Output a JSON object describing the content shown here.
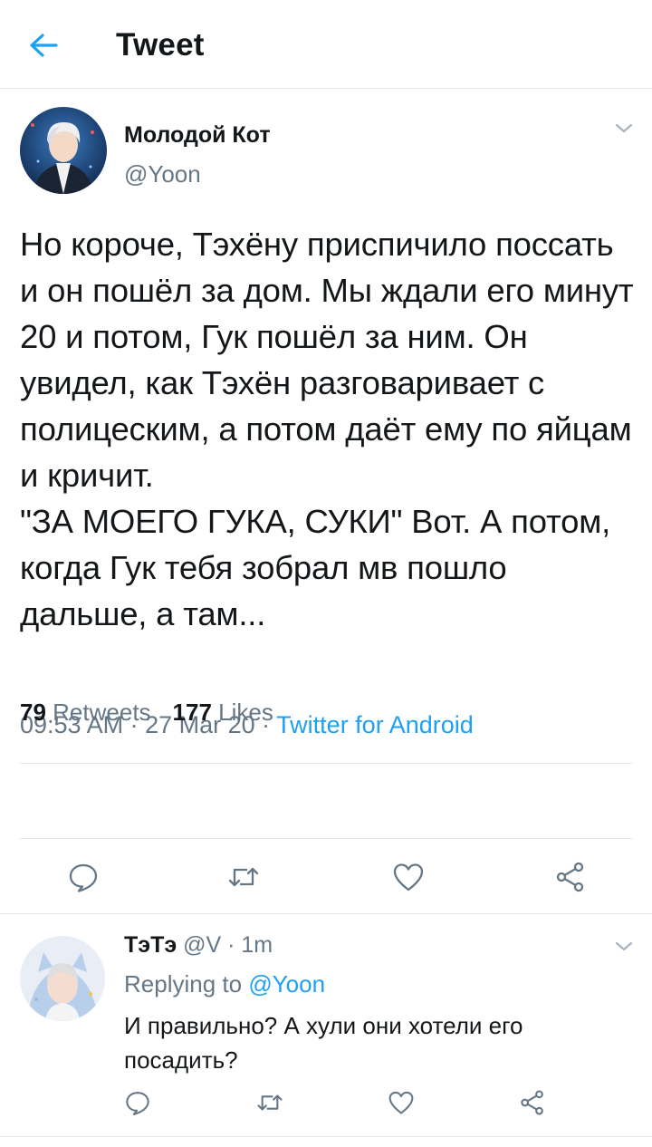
{
  "header": {
    "title": "Tweet"
  },
  "tweet": {
    "author_name": "Молодой Кот",
    "author_handle": "@Yoon",
    "text": "Но короче, Тэхёну приспичило поссать и он пошёл за дом. Мы ждали его минут 20 и потом, Гук пошёл за ним. Он увидел, как Тэхён разговаривает с полицеским, а потом даёт ему по яйцам и кричит.\n\"ЗА МОЕГО ГУКА, СУКИ\" Вот. А потом, когда Гук тебя зобрал мв пошло дальше, а там...",
    "time": "09:53 AM",
    "date": "27 Mar 20",
    "source": "Twitter for Android",
    "retweets_count": "79",
    "retweets_label": "Retweets",
    "likes_count": "177",
    "likes_label": "Likes"
  },
  "reply": {
    "name": "ТэТэ",
    "handle": "@V",
    "time": "1m",
    "replying_label": "Replying to",
    "replying_to": "@Yoon",
    "text": "И правильно? А хули они хотели его посадить?"
  },
  "icons": {
    "back": "arrow-left-icon",
    "more": "chevron-down-icon",
    "reply": "comment-bubble-icon",
    "retweet": "retweet-icon",
    "like": "heart-icon",
    "share": "share-icon"
  },
  "colors": {
    "accent": "#1da1f2",
    "text": "#14171a",
    "secondary": "#657786",
    "divider": "#e1e8ed"
  }
}
